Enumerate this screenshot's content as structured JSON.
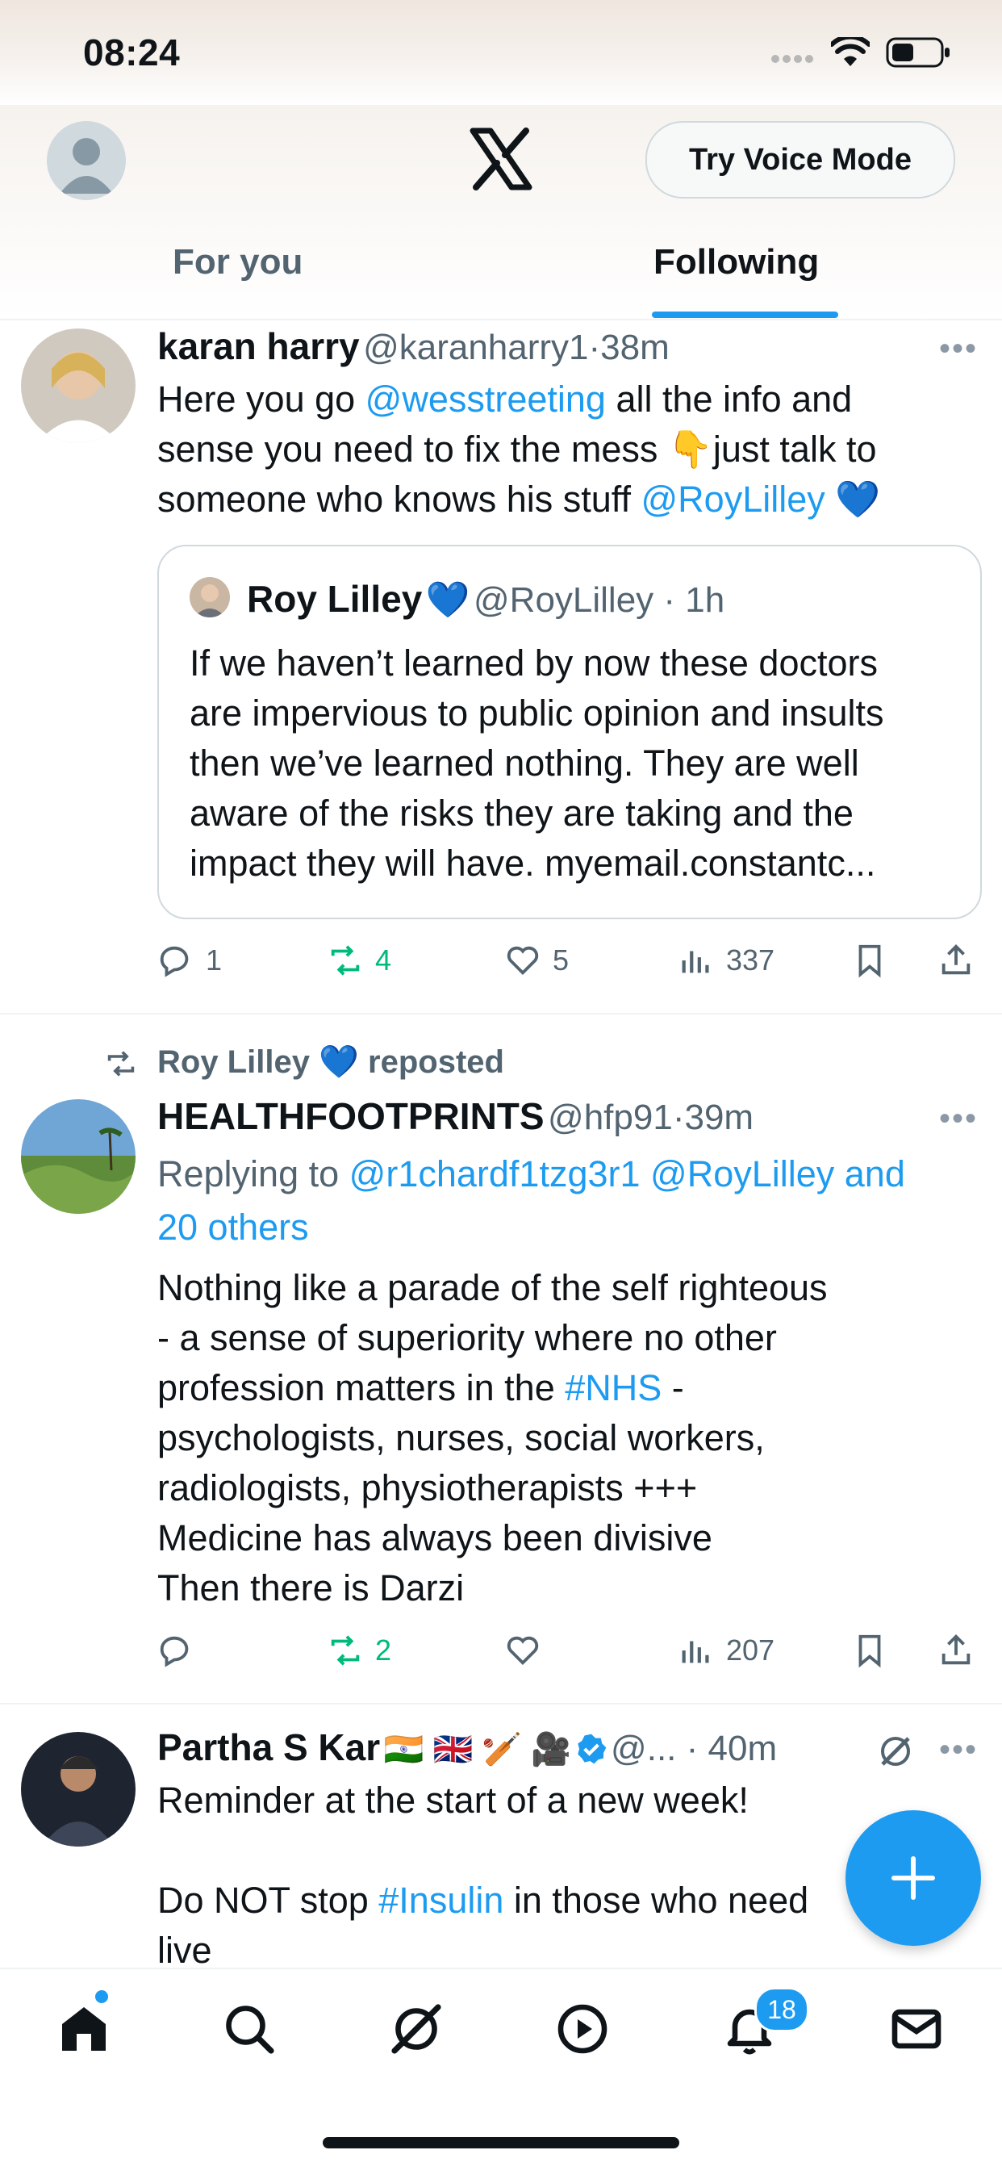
{
  "status_bar": {
    "time": "08:24"
  },
  "header": {
    "voice_button": "Try Voice Mode"
  },
  "tabs": [
    {
      "label": "For you"
    },
    {
      "label": "Following"
    }
  ],
  "posts": [
    {
      "name": "karan harry",
      "handle": "@karanharry1",
      "time": "38m",
      "body_parts": [
        "Here you go ",
        "@wesstreeting",
        " all the info and",
        "sense you need to fix the mess ",
        "👇",
        "just talk to",
        "someone who knows his stuff ",
        "@RoyLilley",
        "💙"
      ],
      "quote": {
        "name": "Roy Lilley",
        "heart": "💙",
        "handle": "@RoyLilley",
        "time": "1h",
        "lines": [
          "If we haven’t learned by now these doctors",
          "are impervious to public opinion and insults",
          "then we’ve learned nothing. They are well",
          "aware of the risks they are taking and the",
          "impact they will have. myemail.constantc..."
        ]
      },
      "replies": "1",
      "reposts": "4",
      "likes": "5",
      "views": "337"
    },
    {
      "repost_by": "Roy Lilley",
      "repost_heart": "💙",
      "repost_label": "reposted",
      "name": "HEALTHFOOTPRINTS",
      "handle": "@hfp91",
      "time": "39m",
      "replying_label": "Replying to",
      "replying_line1": "@r1chardf1tzg3r1 @RoyLilley and",
      "replying_line2": "20 others",
      "lines": [
        "Nothing like a parade of the self righteous",
        "- a sense of superiority where no other",
        "profession matters in the ",
        "#NHS",
        " -",
        "psychologists, nurses, social workers,",
        "radiologists, physiotherapists +++",
        "Medicine has always been divisive",
        "Then there is Darzi"
      ],
      "replies": "",
      "reposts": "2",
      "likes": "",
      "views": "207"
    },
    {
      "name": "Partha S Kar",
      "flags": "🇮🇳 🇬🇧 🏏 🎥",
      "handle": "@...",
      "time": "40m",
      "line1": "Reminder at the start of a new week!",
      "line2a": "Do NOT stop ",
      "line2b": "#Insulin",
      "line2c": " in those who need",
      "line3": "live"
    }
  ],
  "nav": {
    "notifications_count": "18"
  },
  "icons": [
    "avatar-icon",
    "x-logo-icon",
    "reply-icon",
    "repost-icon",
    "like-icon",
    "views-icon",
    "bookmark-icon",
    "share-icon",
    "more-icon",
    "grok-icon",
    "verified-icon",
    "compose-icon",
    "home-icon",
    "search-icon",
    "play-icon",
    "bell-icon",
    "mail-icon"
  ],
  "colors": {
    "accent": "#1d9bf0",
    "repost_green": "#00ba7c",
    "text": "#0f1419",
    "muted": "#536471"
  }
}
